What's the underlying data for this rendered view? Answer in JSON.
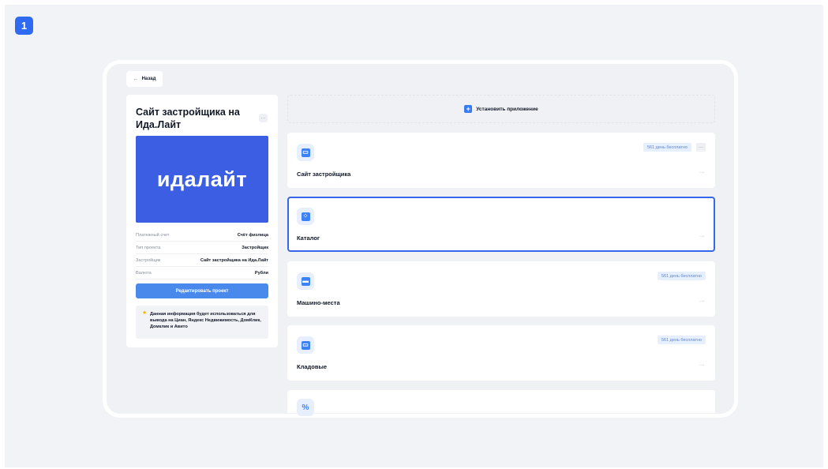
{
  "step_number": "1",
  "back_button": {
    "label": "Назад"
  },
  "project": {
    "title": "Сайт застройщика на Ида.Лайт",
    "more_label": "···",
    "logo_text": "идалайт",
    "info": [
      {
        "key": "Платежный счет",
        "value": "Счёт физлица"
      },
      {
        "key": "Тип проекта",
        "value": "Застройщик"
      },
      {
        "key": "Застройщик",
        "value": "Сайт застройщика на Ида.Лайт"
      },
      {
        "key": "Валюта",
        "value": "Рубли"
      }
    ],
    "edit_button": "Редактировать проект",
    "note": "Данная информация будет использоваться для вывода на Циан, Яндекс Недвижимость, ДомКлик, Домклик и Авито"
  },
  "install": {
    "label": "Установить приложение",
    "icon": "plus-icon"
  },
  "apps": [
    {
      "title": "Сайт застройщика",
      "badge": "561 день бесплатно",
      "has_more": true,
      "icon": "website-icon"
    },
    {
      "title": "Каталог",
      "badge": "",
      "has_more": false,
      "icon": "catalog-icon",
      "selected": true
    },
    {
      "title": "Машино-места",
      "badge": "561 день бесплатно",
      "has_more": false,
      "icon": "car-icon"
    },
    {
      "title": "Кладовые",
      "badge": "561 день бесплатно",
      "has_more": false,
      "icon": "storage-icon"
    },
    {
      "title": "",
      "badge": "",
      "has_more": false,
      "icon": "percent-icon"
    }
  ],
  "colors": {
    "accent": "#3468e8",
    "logo_bg": "#3b5ee2",
    "badge_bg": "#e6effd",
    "button": "#4a89ec"
  }
}
